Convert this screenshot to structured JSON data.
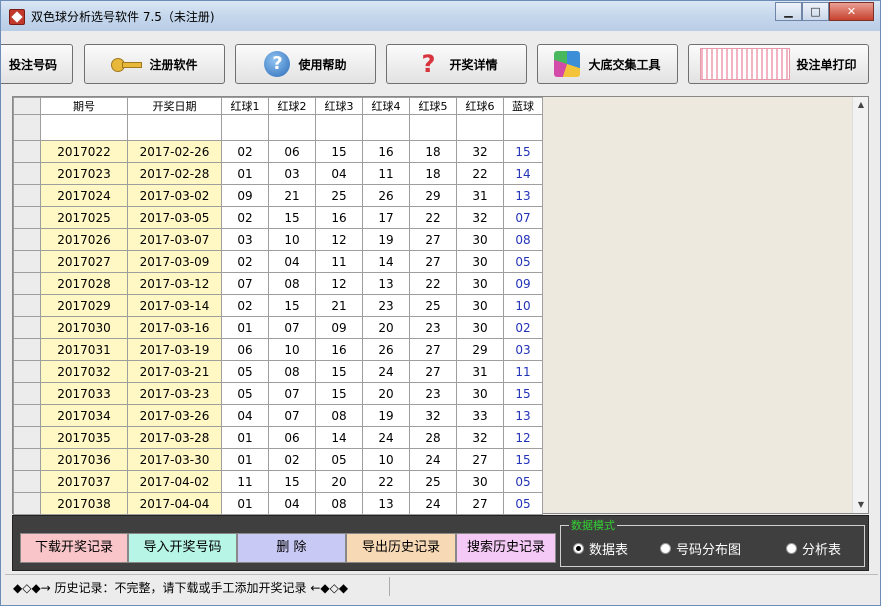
{
  "window": {
    "title": "双色球分析选号软件 7.5（未注册)"
  },
  "toolbar": {
    "bet_numbers": "投注号码",
    "register": "注册软件",
    "help": "使用帮助",
    "draw_details": "开奖详情",
    "combination_tool": "大底交集工具",
    "print_bet_slip": "投注单打印"
  },
  "table": {
    "headers": [
      "期号",
      "开奖日期",
      "红球1",
      "红球2",
      "红球3",
      "红球4",
      "红球5",
      "红球6",
      "蓝球"
    ],
    "rows": [
      [
        "2017022",
        "2017-02-26",
        "02",
        "06",
        "15",
        "16",
        "18",
        "32",
        "15"
      ],
      [
        "2017023",
        "2017-02-28",
        "01",
        "03",
        "04",
        "11",
        "18",
        "22",
        "14"
      ],
      [
        "2017024",
        "2017-03-02",
        "09",
        "21",
        "25",
        "26",
        "29",
        "31",
        "13"
      ],
      [
        "2017025",
        "2017-03-05",
        "02",
        "15",
        "16",
        "17",
        "22",
        "32",
        "07"
      ],
      [
        "2017026",
        "2017-03-07",
        "03",
        "10",
        "12",
        "19",
        "27",
        "30",
        "08"
      ],
      [
        "2017027",
        "2017-03-09",
        "02",
        "04",
        "11",
        "14",
        "27",
        "30",
        "05"
      ],
      [
        "2017028",
        "2017-03-12",
        "07",
        "08",
        "12",
        "13",
        "22",
        "30",
        "09"
      ],
      [
        "2017029",
        "2017-03-14",
        "02",
        "15",
        "21",
        "23",
        "25",
        "30",
        "10"
      ],
      [
        "2017030",
        "2017-03-16",
        "01",
        "07",
        "09",
        "20",
        "23",
        "30",
        "02"
      ],
      [
        "2017031",
        "2017-03-19",
        "06",
        "10",
        "16",
        "26",
        "27",
        "29",
        "03"
      ],
      [
        "2017032",
        "2017-03-21",
        "05",
        "08",
        "15",
        "24",
        "27",
        "31",
        "11"
      ],
      [
        "2017033",
        "2017-03-23",
        "05",
        "07",
        "15",
        "20",
        "23",
        "30",
        "15"
      ],
      [
        "2017034",
        "2017-03-26",
        "04",
        "07",
        "08",
        "19",
        "32",
        "33",
        "13"
      ],
      [
        "2017035",
        "2017-03-28",
        "01",
        "06",
        "14",
        "24",
        "28",
        "32",
        "12"
      ],
      [
        "2017036",
        "2017-03-30",
        "01",
        "02",
        "05",
        "10",
        "24",
        "27",
        "15"
      ],
      [
        "2017037",
        "2017-04-02",
        "11",
        "15",
        "20",
        "22",
        "25",
        "30",
        "05"
      ],
      [
        "2017038",
        "2017-04-04",
        "01",
        "04",
        "08",
        "13",
        "24",
        "27",
        "05"
      ]
    ]
  },
  "actions": {
    "download": "下载开奖记录",
    "import": "导入开奖号码",
    "delete": "删 除",
    "export": "导出历史记录",
    "search": "搜索历史记录"
  },
  "mode": {
    "label": "数据模式",
    "options": [
      "数据表",
      "号码分布图",
      "分析表"
    ],
    "selected": "数据表"
  },
  "status": {
    "history": "◆◇◆→ 历史记录：不完整，请下载或手工添加开奖记录 ←◆◇◆"
  },
  "colors": {
    "download": "#f9c5c8",
    "import": "#b7f5e6",
    "delete": "#c9c9f5",
    "export": "#f8d9b6",
    "search": "#f5c9f5"
  }
}
